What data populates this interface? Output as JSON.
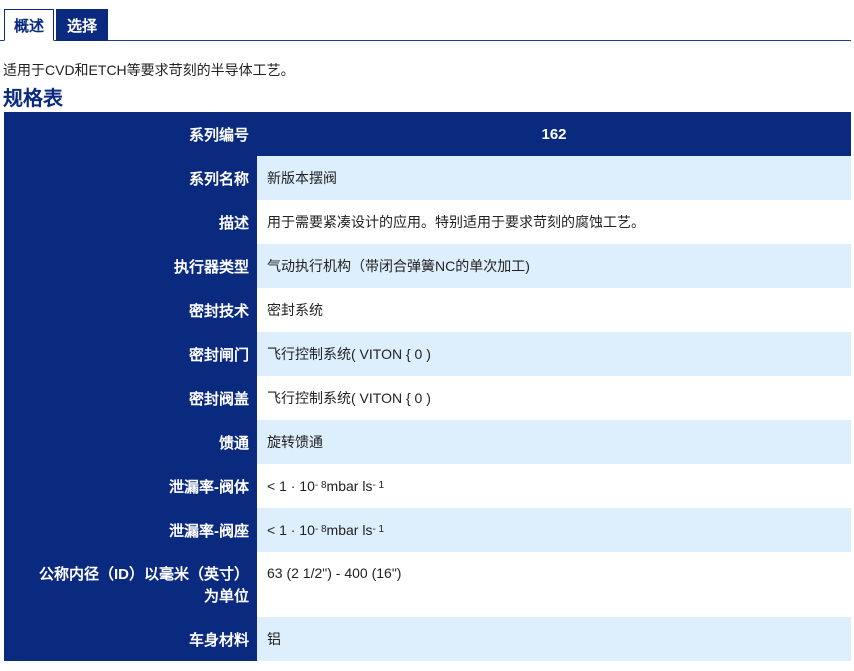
{
  "tabs": [
    {
      "label": "概述",
      "active": true
    },
    {
      "label": "选择",
      "active": false
    }
  ],
  "intro_text": "适用于CVD和ETCH等要求苛刻的半导体工艺。",
  "spec_title": "规格表",
  "spec_rows": [
    {
      "label": "系列编号",
      "value": "162"
    },
    {
      "label": "系列名称",
      "value": "新版本摆阀"
    },
    {
      "label": "描述",
      "value": "用于需要紧凑设计的应用。特别适用于要求苛刻的腐蚀工艺。"
    },
    {
      "label": "执行器类型",
      "value": "气动执行机构（带闭合弹簧NC的单次加工)"
    },
    {
      "label": "密封技术",
      "value": "密封系统"
    },
    {
      "label": "密封闸门",
      "value": "飞行控制系统( VITON { 0 )"
    },
    {
      "label": "密封阀盖",
      "value": "飞行控制系统( VITON { 0 )"
    },
    {
      "label": "馈通",
      "value": "旋转馈通"
    },
    {
      "label": "泄漏率-阀体",
      "value_prefix": "< 1 · 10",
      "value_exp1": "- 8",
      "value_mid": " mbar ls",
      "value_exp2": "- 1"
    },
    {
      "label": "泄漏率-阀座",
      "value_prefix": "< 1 · 10",
      "value_exp1": "- 8",
      "value_mid": " mbar ls",
      "value_exp2": "- 1"
    },
    {
      "label_line1": "公称内径（ID）以毫米（英寸）",
      "label_line2": "为单位",
      "value": "63 (2 1/2\") - 400 (16\")"
    },
    {
      "label": "车身材料",
      "value": "铝"
    }
  ],
  "colors": {
    "brand_blue": "#0a2a80",
    "row_alt": "#ddeefc"
  }
}
